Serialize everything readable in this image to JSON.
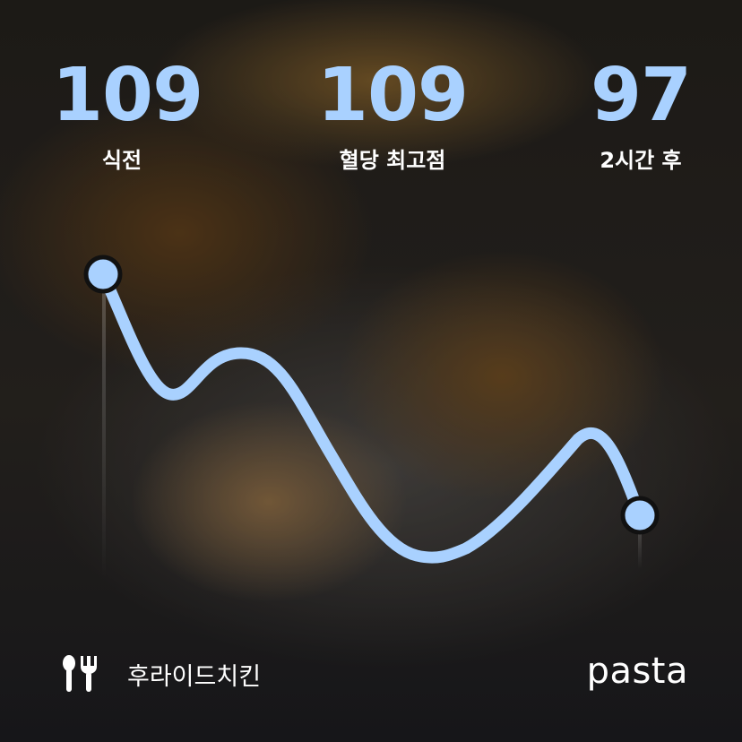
{
  "stats": {
    "before": {
      "value": "109",
      "label": "식전"
    },
    "peak": {
      "value": "109",
      "label": "혈당 최고점"
    },
    "after": {
      "value": "97",
      "label": "2시간 후"
    }
  },
  "food": {
    "icon": "utensils-icon",
    "name": "후라이드치킨"
  },
  "brand": "pasta",
  "colors": {
    "accent": "#a9d1ff",
    "marker_outline": "#111111",
    "text": "#ffffff"
  }
}
